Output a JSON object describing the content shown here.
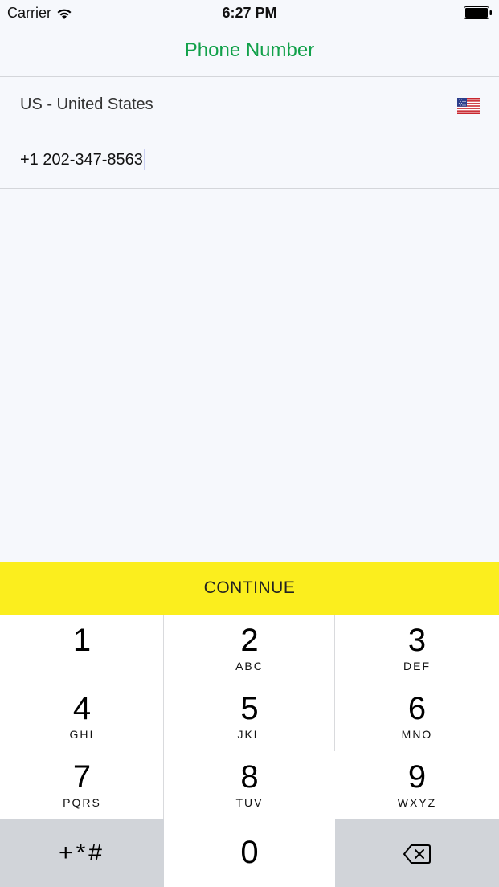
{
  "status_bar": {
    "carrier": "Carrier",
    "time": "6:27 PM",
    "wifi_icon": "wifi-icon",
    "battery_icon": "battery-icon"
  },
  "nav": {
    "title": "Phone Number",
    "title_color": "#12a14a"
  },
  "country": {
    "label": "US - United States",
    "flag_icon": "us-flag-icon"
  },
  "phone": {
    "value": "+1 202-347-8563"
  },
  "continue_button": {
    "label": "CONTINUE",
    "color": "#fbee1e"
  },
  "keypad": {
    "keys": [
      {
        "digit": "1",
        "letters": ""
      },
      {
        "digit": "2",
        "letters": "ABC"
      },
      {
        "digit": "3",
        "letters": "DEF"
      },
      {
        "digit": "4",
        "letters": "GHI"
      },
      {
        "digit": "5",
        "letters": "JKL"
      },
      {
        "digit": "6",
        "letters": "MNO"
      },
      {
        "digit": "7",
        "letters": "PQRS"
      },
      {
        "digit": "8",
        "letters": "TUV"
      },
      {
        "digit": "9",
        "letters": "WXYZ"
      },
      {
        "digit": "0",
        "letters": ""
      }
    ],
    "symbols_label": "+*#",
    "delete_icon": "backspace-icon",
    "gray_key_color": "#d1d4d9"
  }
}
